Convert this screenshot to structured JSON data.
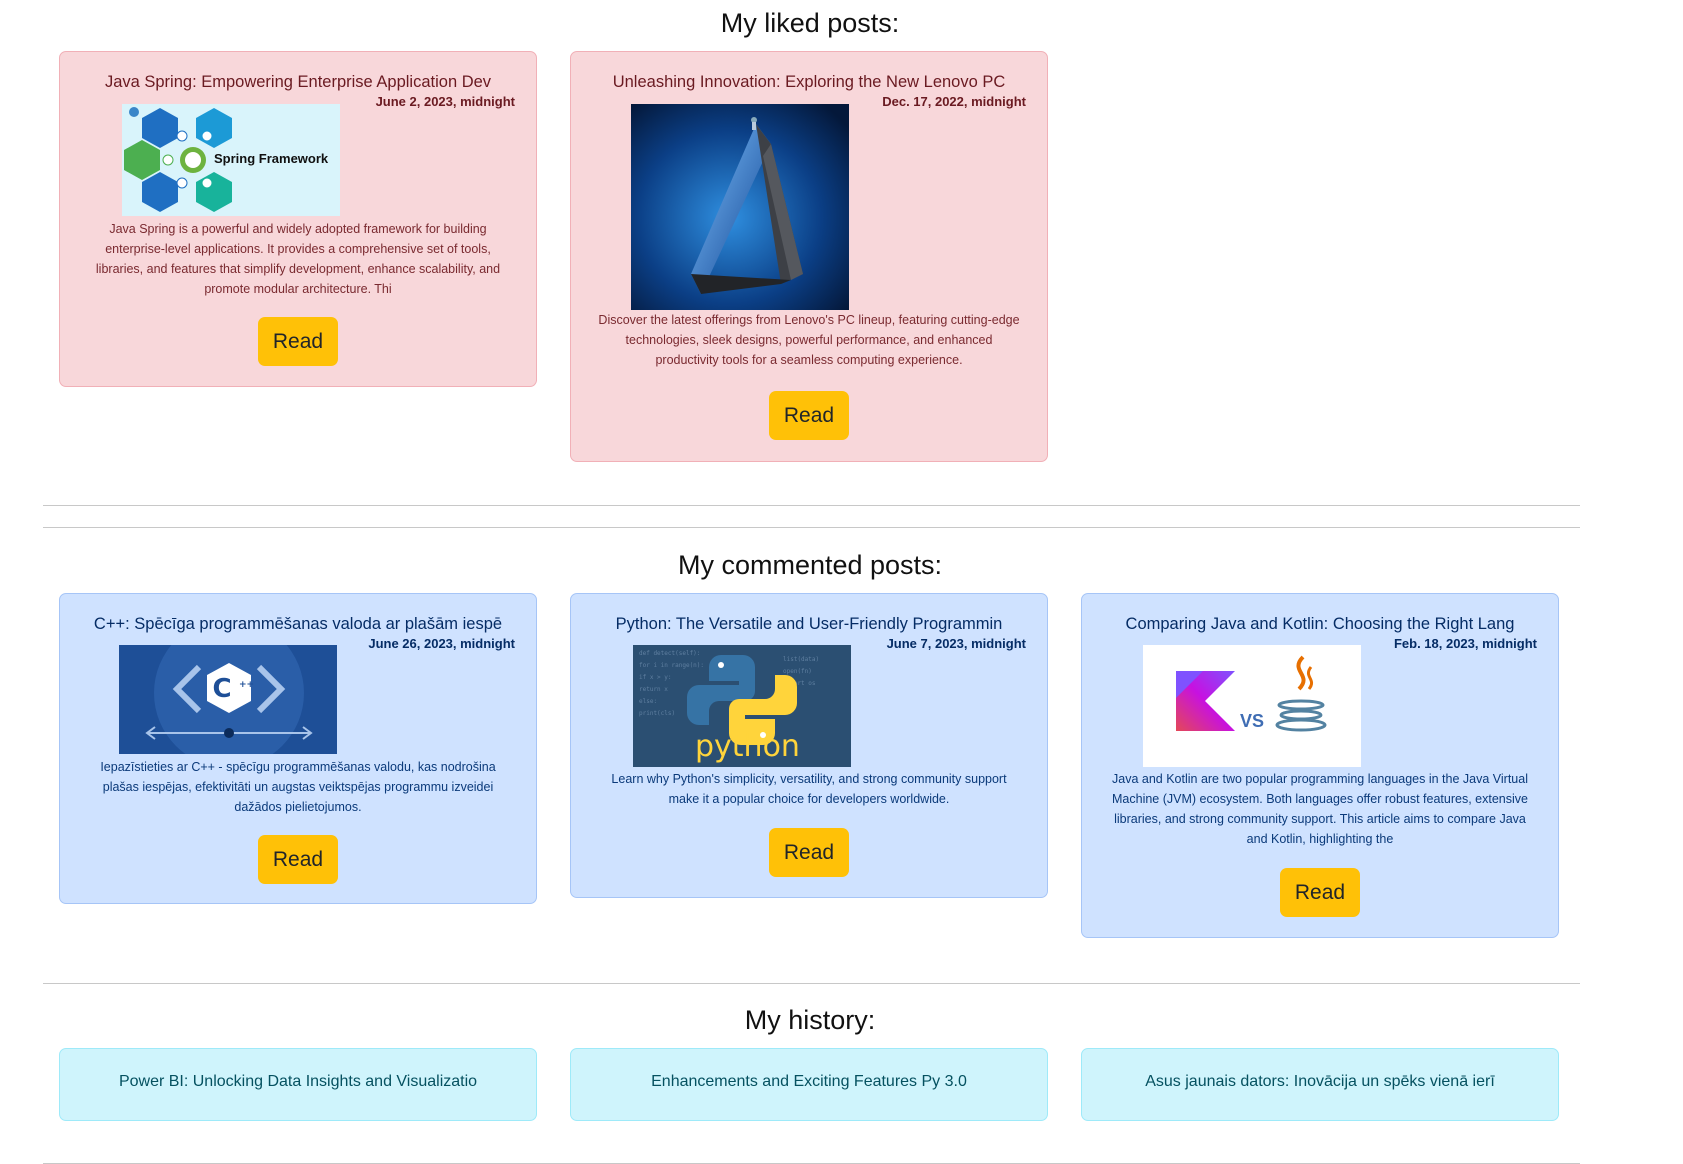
{
  "liked": {
    "title": "My liked posts:",
    "posts": [
      {
        "title": "Java Spring: Empowering Enterprise Application Dev",
        "date": "June 2, 2023, midnight",
        "image_label": "Spring Framework",
        "excerpt": "Java Spring is a powerful and widely adopted framework for building enterprise-level applications. It provides a comprehensive set of tools, libraries, and features that simplify development, enhance scalability, and promote modular architecture. Thi",
        "button": "Read"
      },
      {
        "title": "Unleashing Innovation: Exploring the New Lenovo PC",
        "date": "Dec. 17, 2022, midnight",
        "excerpt": "Discover the latest offerings from Lenovo's PC lineup, featuring cutting-edge technologies, sleek designs, powerful performance, and enhanced productivity tools for a seamless computing experience.",
        "button": "Read"
      }
    ]
  },
  "commented": {
    "title": "My commented posts:",
    "posts": [
      {
        "title": "C++: Spēcīga programmēšanas valoda ar plašām iespē",
        "date": "June 26, 2023, midnight",
        "excerpt": "Iepazīstieties ar C++ - spēcīgu programmēšanas valodu, kas nodrošina plašas iespējas, efektivitāti un augstas veiktspējas programmu izveidei dažādos pielietojumos.",
        "button": "Read"
      },
      {
        "title": "Python: The Versatile and User-Friendly Programmin",
        "date": "June 7, 2023, midnight",
        "image_label": "python",
        "excerpt": "Learn why Python's simplicity, versatility, and strong community support make it a popular choice for developers worldwide.",
        "button": "Read"
      },
      {
        "title": "Comparing Java and Kotlin: Choosing the Right Lang",
        "date": "Feb. 18, 2023, midnight",
        "image_label": "VS",
        "excerpt": "Java and Kotlin are two popular programming languages in the Java Virtual Machine (JVM) ecosystem. Both languages offer robust features, extensive libraries, and strong community support. This article aims to compare Java and Kotlin, highlighting the",
        "button": "Read"
      }
    ]
  },
  "history": {
    "title": "My history:",
    "items": [
      "Power BI: Unlocking Data Insights and Visualizatio",
      "Enhancements and Exciting Features Py 3.0",
      "Asus jaunais dators: Inovācija un spēks vienā ierī"
    ]
  },
  "colors": {
    "liked_bg": "#f8d7da",
    "commented_bg": "#cfe2ff",
    "history_bg": "#cff4fc",
    "button": "#ffc107"
  }
}
